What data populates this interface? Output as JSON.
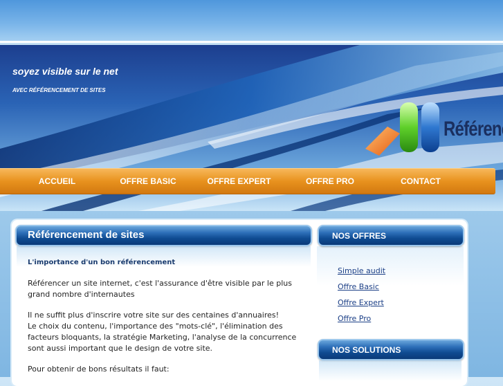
{
  "banner": {
    "tagline": "soyez visible sur le net",
    "subtagline": "AVEC RÉFÉRENCEMENT DE SITES",
    "logo_text": "Référenc"
  },
  "nav": {
    "items": [
      "ACCUEIL",
      "OFFRE BASIC",
      "OFFRE EXPERT",
      "OFFRE PRO",
      "CONTACT"
    ]
  },
  "main": {
    "title": "Référencement de sites",
    "heading": "L'importance d'un bon référencement",
    "paragraphs": [
      "Référencer un site internet, c'est l'assurance d'être visible par le plus grand nombre d'internautes",
      "Il ne suffit plus d'inscrire votre site sur des centaines d'annuaires!",
      "Le choix du contenu, l'importance des \"mots-clé\", l'élimination des facteurs bloquants, la stratégie Marketing, l'analyse de la concurrence sont aussi important que le design de votre site.",
      "Pour obtenir de bons résultats il faut:"
    ]
  },
  "sidebar": {
    "offres_title": "NOS OFFRES",
    "offres_links": [
      "Simple audit",
      "Offre Basic",
      "Offre Expert",
      "Offre Pro"
    ],
    "solutions_title": "NOS SOLUTIONS"
  },
  "colors": {
    "nav_orange": "#e8921e",
    "header_blue": "#0f4b92",
    "link_blue": "#1b3f86"
  }
}
